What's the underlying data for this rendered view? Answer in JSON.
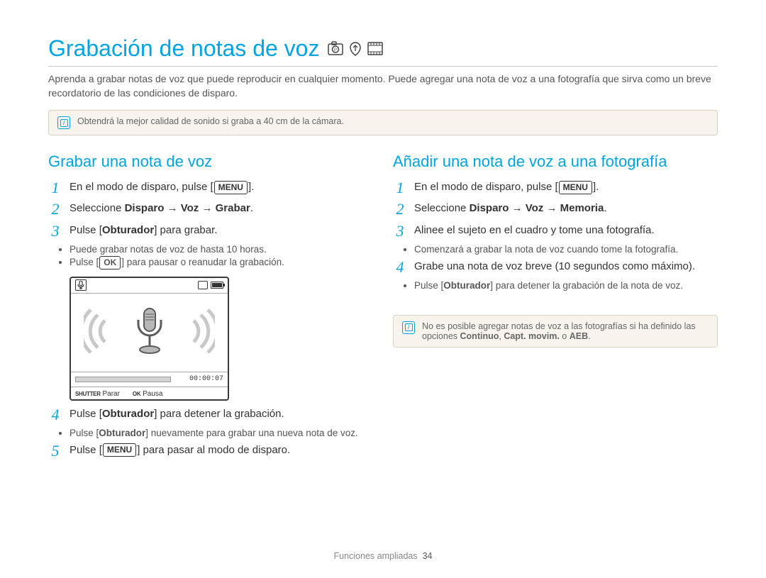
{
  "title": "Grabación de notas de voz",
  "intro": "Aprenda a grabar notas de voz que puede reproducir en cualquier momento. Puede agregar una nota de voz a una fotografía que sirva como un breve recordatorio de las condiciones de disparo.",
  "tip_box": "Obtendrá la mejor calidad de sonido si graba a 40 cm de la cámara.",
  "left": {
    "heading": "Grabar una nota de voz",
    "steps": {
      "s1_pre": "En el modo de disparo, pulse [",
      "s1_key": "MENU",
      "s1_post": "].",
      "s2_pre": "Seleccione ",
      "s2_bold": "Disparo → Voz → Grabar",
      "s2_post": ".",
      "s3_pre": "Pulse [",
      "s3_bold": "Obturador",
      "s3_post": "] para grabar.",
      "s3_b1": "Puede grabar notas de voz de hasta 10 horas.",
      "s3_b2_pre": "Pulse [",
      "s3_b2_key": "OK",
      "s3_b2_post": "] para pausar o reanudar la grabación.",
      "s4_pre": "Pulse [",
      "s4_bold": "Obturador",
      "s4_post": "] para detener la grabación.",
      "s4_b1_pre": "Pulse [",
      "s4_b1_bold": "Obturador",
      "s4_b1_post": "] nuevamente para grabar una nueva nota de voz.",
      "s5_pre": "Pulse [",
      "s5_key": "MENU",
      "s5_post": "] para pasar al modo de disparo."
    },
    "lcd": {
      "timer": "00:00:07",
      "shutter_label": "SHUTTER",
      "parar": "Parar",
      "ok_label": "OK",
      "pausa": "Pausa"
    }
  },
  "right": {
    "heading": "Añadir una nota de voz a una fotografía",
    "steps": {
      "s1_pre": "En el modo de disparo, pulse [",
      "s1_key": "MENU",
      "s1_post": "].",
      "s2_pre": "Seleccione ",
      "s2_bold": "Disparo → Voz → Memoria",
      "s2_post": ".",
      "s3": "Alinee el sujeto en el cuadro y tome una fotografía.",
      "s3_b1": "Comenzará a grabar la nota de voz cuando tome la fotografía.",
      "s4": "Grabe una nota de voz breve (10 segundos como máximo).",
      "s4_b1_pre": "Pulse [",
      "s4_b1_bold": "Obturador",
      "s4_b1_post": "] para detener la grabación de la nota de voz."
    },
    "note_pre": "No es posible agregar notas de voz a las fotografías si ha definido las opciones ",
    "note_b1": "Continuo",
    "note_sep1": ", ",
    "note_b2": "Capt. movim.",
    "note_sep2": " o ",
    "note_b3": "AEB",
    "note_post": "."
  },
  "footer_label": "Funciones ampliadas",
  "footer_page": "34"
}
